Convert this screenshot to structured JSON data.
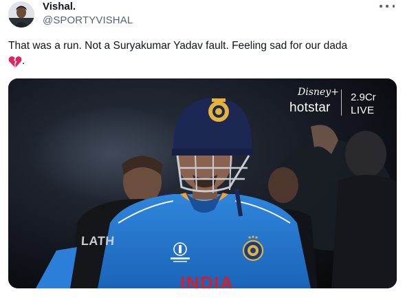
{
  "tweet": {
    "display_name": "Vishal.",
    "handle": "@SPORTYVISHAL",
    "text_line1": "That was a run. Not a Suryakumar Yadav fault. Feeling sad for our dada",
    "text_line2_suffix": ".",
    "emoji": "broken-heart-icon"
  },
  "media": {
    "overlay": {
      "brand_top": "Disney+",
      "brand_bottom": "hotstar",
      "viewers": "2.9Cr",
      "live_label": "LIVE"
    },
    "jersey_text": "INDIA",
    "opponent_shirt_text": "LATH"
  },
  "colors": {
    "text_primary": "#0f1419",
    "text_secondary": "#536471",
    "india_blue": "#1d6fc4",
    "jersey_red": "#d31f2a",
    "heart_red": "#e0245e"
  }
}
